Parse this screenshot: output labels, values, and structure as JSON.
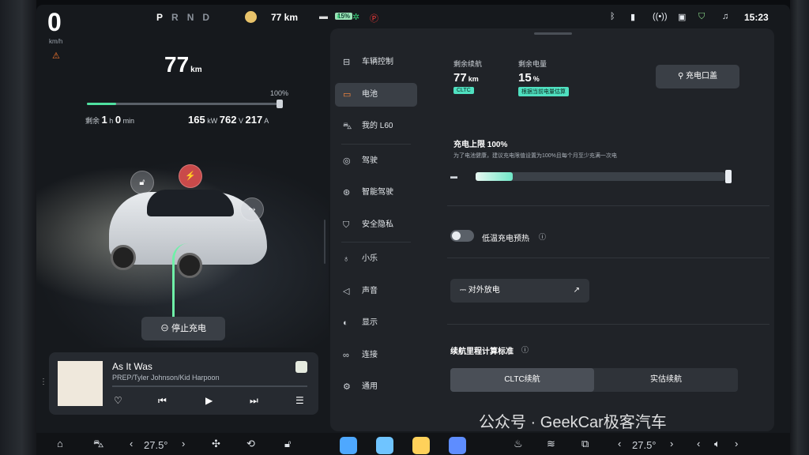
{
  "status": {
    "speed": "0",
    "speed_unit": "km/h",
    "gears": [
      "P",
      "R",
      "N",
      "D"
    ],
    "range": "77 km",
    "battery_badge": "15%",
    "clock": "15:23"
  },
  "battery_card": {
    "range_value": "77",
    "range_unit": "km",
    "percent_label": "100%",
    "charge_level": 0.15,
    "remaining_label": "剩余",
    "remaining_h": "1",
    "h_unit": "h",
    "remaining_min": "0",
    "min_unit": "min",
    "power": "165",
    "power_unit": "kW",
    "voltage": "762",
    "voltage_unit": "V",
    "current": "217",
    "current_unit": "A",
    "stop_charge_label": "停止充电"
  },
  "music": {
    "title": "As It Was",
    "artist": "PREP/Tyler Johnson/Kid Harpoon"
  },
  "nav": [
    {
      "label": "车辆控制",
      "icon": "toggle-icon"
    },
    {
      "label": "电池",
      "icon": "battery-icon",
      "active": true
    },
    {
      "label": "我的 L60",
      "icon": "car-icon"
    },
    {
      "label": "驾驶",
      "icon": "steering-wheel-icon"
    },
    {
      "label": "智能驾驶",
      "icon": "autopilot-icon"
    },
    {
      "label": "安全隐私",
      "icon": "shield-icon"
    },
    {
      "label": "小乐",
      "icon": "microphone-icon"
    },
    {
      "label": "声音",
      "icon": "speaker-icon"
    },
    {
      "label": "显示",
      "icon": "display-icon"
    },
    {
      "label": "连接",
      "icon": "link-icon"
    },
    {
      "label": "通用",
      "icon": "gear-icon"
    }
  ],
  "battery_settings": {
    "range_label": "剩余续航",
    "range_value": "77",
    "range_unit": "km",
    "range_tag": "CLTC",
    "soc_label": "剩余电量",
    "soc_value": "15",
    "soc_unit": "%",
    "soc_tag": "根据当前电量估算",
    "port_button": "充电口盖",
    "charge_limit_title": "充电上限 100%",
    "charge_limit_note": "为了电池健康，建议充电限值设置为100%且每个月至少充满一次电",
    "charge_limit_fill": 0.15,
    "preheat_label": "低温充电预热",
    "discharge_label": "对外放电",
    "standard_title": "续航里程计算标准",
    "standard_options": [
      "CLTC续航",
      "实估续航"
    ]
  },
  "dock": {
    "temp_left": "27.5°",
    "temp_right": "27.5°"
  },
  "watermark": "公众号 · GeekCar极客汽车",
  "colors": {
    "accent": "#4fe0a0",
    "active_icon": "#ff8a3d",
    "panel": "#202328"
  }
}
